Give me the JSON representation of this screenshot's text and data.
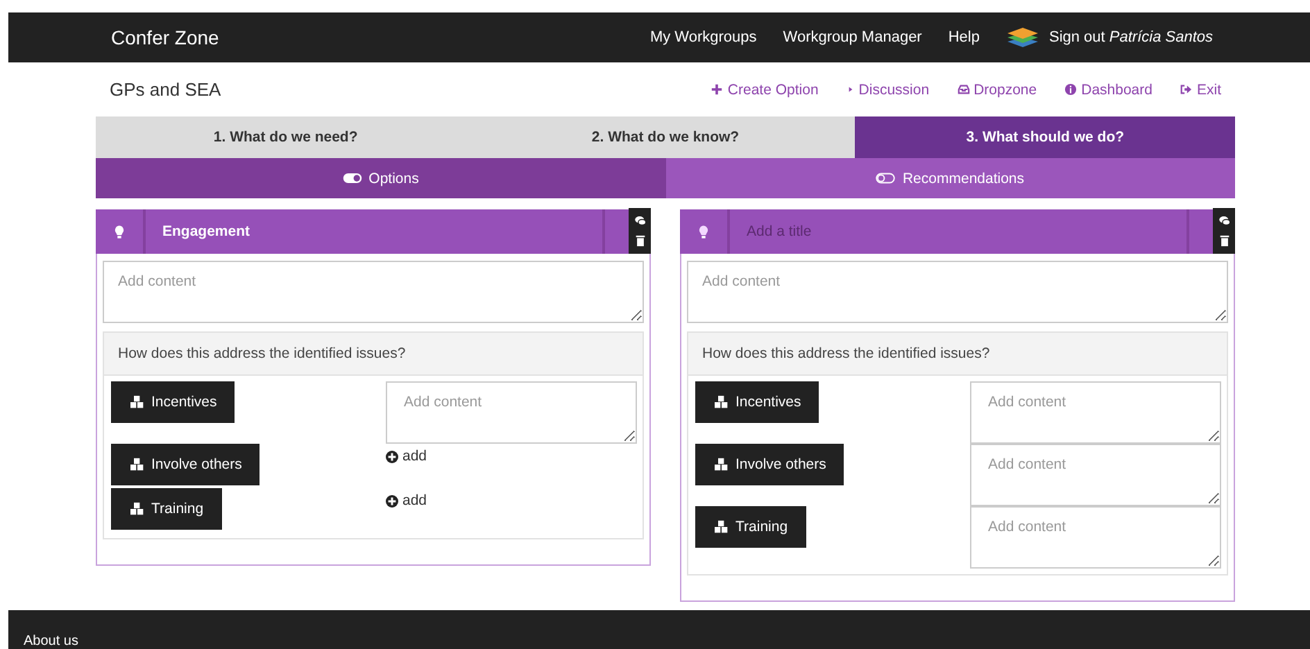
{
  "topbar": {
    "brand": "Confer Zone",
    "nav": [
      "My Workgroups",
      "Workgroup Manager",
      "Help"
    ],
    "signout": "Sign out *Patrícia Santos*"
  },
  "toolbar": {
    "title": "GPs and SEA",
    "links": [
      {
        "label": "Create Option"
      },
      {
        "label": "Discussion"
      },
      {
        "label": "Dropzone"
      },
      {
        "label": "Dashboard"
      },
      {
        "label": "Exit"
      }
    ]
  },
  "steps": [
    {
      "label": "1. What do we need?",
      "selected": false
    },
    {
      "label": "2. What do we know?",
      "selected": false
    },
    {
      "label": "3. What should we do?",
      "selected": true
    }
  ],
  "subtabs": [
    {
      "label": "Options",
      "selected": true
    },
    {
      "label": "Recommendations",
      "selected": false
    }
  ],
  "cards": [
    {
      "title": "Engagement",
      "content_placeholder": "Add content",
      "question": "How does this address the identified issues?",
      "issues": [
        {
          "label": "Incentives",
          "kind": "field",
          "placeholder": "Add content"
        },
        {
          "label": "Involve others",
          "kind": "add",
          "action": "add"
        },
        {
          "label": "Training",
          "kind": "add",
          "action": "add"
        }
      ]
    },
    {
      "title_placeholder": "Add a title",
      "content_placeholder": "Add content",
      "question": "How does this address the identified issues?",
      "issues": [
        {
          "label": "Incentives",
          "kind": "field",
          "placeholder": "Add content"
        },
        {
          "label": "Involve others",
          "kind": "field",
          "placeholder": "Add content"
        },
        {
          "label": "Training",
          "kind": "field",
          "placeholder": "Add content"
        }
      ]
    }
  ],
  "footer": {
    "link": "About us"
  }
}
